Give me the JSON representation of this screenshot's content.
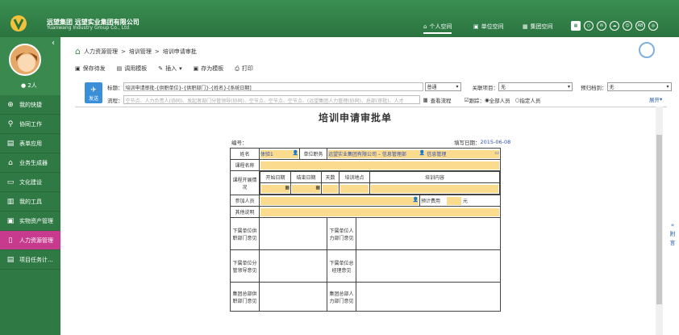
{
  "header": {
    "brand_cn": "远望集团  远望实业集团有限公司",
    "brand_en": "Yuanwang Industry Group Co., Ltd.",
    "nav": [
      {
        "label": "个人空间",
        "icon": "home-icon",
        "active": true
      },
      {
        "label": "单位空间",
        "icon": "building-icon"
      },
      {
        "label": "集团空间",
        "icon": "group-icon"
      }
    ],
    "icon_ab_label": "AB",
    "accent": "#2b7440"
  },
  "sidebar": {
    "user_count": "2人",
    "items": [
      {
        "label": "我的快捷",
        "icon": "plus-icon"
      },
      {
        "label": "协同工作",
        "icon": "cooperation-icon"
      },
      {
        "label": "表单应用",
        "icon": "form-icon"
      },
      {
        "label": "业务生成器",
        "icon": "builder-icon"
      },
      {
        "label": "文化建设",
        "icon": "culture-icon"
      },
      {
        "label": "我的工具",
        "icon": "tools-icon"
      },
      {
        "label": "实物资产管理",
        "icon": "asset-icon"
      },
      {
        "label": "人力资源管理",
        "icon": "hr-icon",
        "active": true
      },
      {
        "label": "项目任务计...",
        "icon": "project-icon"
      }
    ]
  },
  "breadcrumb": [
    "人力资源管理",
    "培训管理",
    "培训申请审批"
  ],
  "toolbar": {
    "save_draft": "保存待发",
    "use_template": "调用模板",
    "insert": "插入",
    "save_template": "存为模板",
    "print": "打印"
  },
  "form": {
    "send_label": "发送",
    "title_label": "标题：",
    "title_value": "培训申请审批-{供职单位}-{供职部门}-{姓名}-[系统日期]",
    "priority": "普通",
    "related_label": "关联项目：",
    "related_value": "无",
    "deadline_label": "预归档到：",
    "deadline_value": "无",
    "flow_label": "流程：",
    "flow_placeholder": "空节点、人力负责人(协同)、发起者部门分管领导(协同)、空节点、空节点、空节点、(远望集团人力管理(协同)、总部(审批)、人才",
    "view_flow": "查看流程",
    "track_label": "跟踪：",
    "all_people": "全部人员",
    "specified_people": "指定人员",
    "expand": "展开"
  },
  "doc": {
    "title": "培训申请审批单",
    "number_label": "编号：",
    "fill_date_label": "填写日期：",
    "fill_date": "2015-06-08",
    "name_label": "姓名",
    "name_value": "体验1",
    "position_label": "单位职务",
    "dept_value": "远望实业集团有限公司 – 信息管理部",
    "role_value": "信息管理",
    "course_label": "课程名称",
    "training_label": "课程开展情况",
    "start_date": "开始日期",
    "end_date": "结束日期",
    "days": "天数",
    "location": "培训地点",
    "content": "培训内容",
    "participants_label": "参加人员",
    "cost_label": "预计费用",
    "unit_yuan": "元",
    "other_label": "其他说明",
    "opinions": [
      {
        "left": "下属单位供职部门意见",
        "right": "下属单位人力部门意见"
      },
      {
        "left": "下属单位分管领导意见",
        "right": "下属单位总经理意见"
      },
      {
        "left": "集团总部供职部门意见",
        "right": "集团总部人力部门意见"
      }
    ]
  },
  "side_note": [
    "附",
    "言"
  ]
}
